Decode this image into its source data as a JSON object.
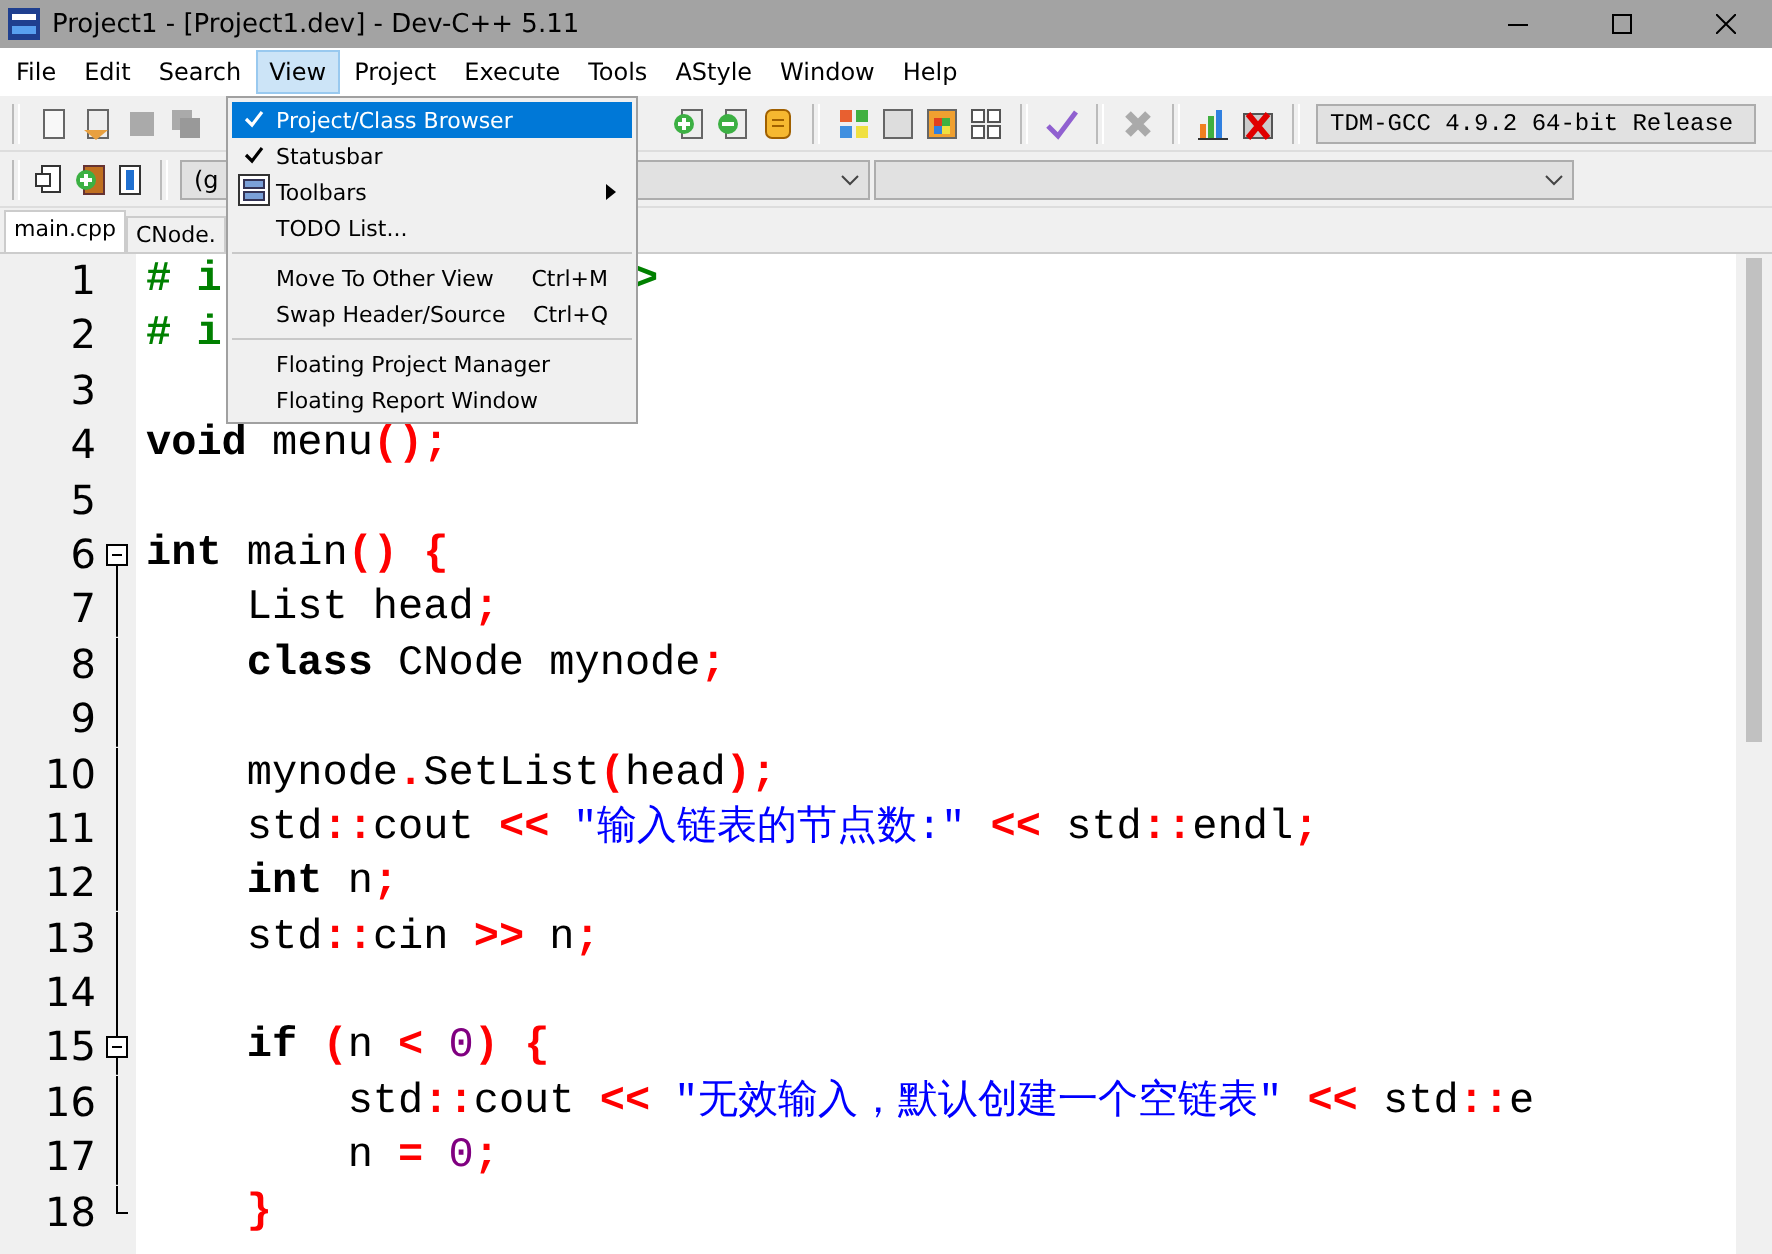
{
  "window": {
    "title": "Project1 - [Project1.dev] - Dev-C++ 5.11"
  },
  "menu_bar": [
    {
      "label": "File",
      "selected": false
    },
    {
      "label": "Edit",
      "selected": false
    },
    {
      "label": "Search",
      "selected": false
    },
    {
      "label": "View",
      "selected": true
    },
    {
      "label": "Project",
      "selected": false
    },
    {
      "label": "Execute",
      "selected": false
    },
    {
      "label": "Tools",
      "selected": false
    },
    {
      "label": "AStyle",
      "selected": false
    },
    {
      "label": "Window",
      "selected": false
    },
    {
      "label": "Help",
      "selected": false
    }
  ],
  "view_menu": {
    "items": [
      {
        "kind": "check",
        "label": "Project/Class Browser",
        "checked": true,
        "selected": true
      },
      {
        "kind": "check",
        "label": "Statusbar",
        "checked": true,
        "selected": false
      },
      {
        "kind": "submenu",
        "label": "Toolbars",
        "selected": false
      },
      {
        "kind": "item",
        "label": "TODO List...",
        "selected": false
      },
      {
        "kind": "separator"
      },
      {
        "kind": "item",
        "label": "Move To Other View",
        "shortcut": "Ctrl+M",
        "selected": false
      },
      {
        "kind": "item",
        "label": "Swap Header/Source",
        "shortcut": "Ctrl+Q",
        "selected": false
      },
      {
        "kind": "separator"
      },
      {
        "kind": "item",
        "label": "Floating Project Manager",
        "selected": false
      },
      {
        "kind": "item",
        "label": "Floating Report Window",
        "selected": false
      }
    ]
  },
  "compiler": {
    "value": "TDM-GCC 4.9.2 64-bit Release"
  },
  "scope_box": {
    "value": "(g"
  },
  "tabs": [
    {
      "label": "main.cpp",
      "selected": true
    },
    {
      "label": "CNode.",
      "selected": false
    }
  ],
  "editor": {
    "lines": [
      {
        "number": "1",
        "tokens": [
          {
            "kind": "pre",
            "text": "# i"
          },
          {
            "kind": "pre",
            "text": ">",
            "after_hidden": true
          }
        ]
      },
      {
        "number": "2",
        "tokens": [
          {
            "kind": "pre",
            "text": "# i"
          }
        ]
      },
      {
        "number": "3"
      },
      {
        "number": "4",
        "tokens": [
          {
            "kind": "kw",
            "text": "void"
          },
          {
            "kind": "id",
            "text": " menu"
          },
          {
            "kind": "sym",
            "text": "();"
          }
        ]
      },
      {
        "number": "5"
      },
      {
        "number": "6",
        "fold_start": true,
        "tokens": [
          {
            "kind": "kw",
            "text": "int"
          },
          {
            "kind": "id",
            "text": " main"
          },
          {
            "kind": "sym",
            "text": "()"
          },
          {
            "kind": "sym",
            "text": " {"
          }
        ]
      },
      {
        "number": "7",
        "tokens": [
          {
            "kind": "id",
            "text": "    List head"
          },
          {
            "kind": "sym",
            "text": ";"
          }
        ]
      },
      {
        "number": "8",
        "tokens": [
          {
            "kind": "kw",
            "text": "    class"
          },
          {
            "kind": "id",
            "text": " CNode mynode"
          },
          {
            "kind": "sym",
            "text": ";"
          }
        ]
      },
      {
        "number": "9"
      },
      {
        "number": "10",
        "tokens": [
          {
            "kind": "id",
            "text": "    mynode"
          },
          {
            "kind": "sym",
            "text": "."
          },
          {
            "kind": "id",
            "text": "SetList"
          },
          {
            "kind": "sym",
            "text": "("
          },
          {
            "kind": "id",
            "text": "head"
          },
          {
            "kind": "sym",
            "text": ");"
          }
        ]
      },
      {
        "number": "11",
        "tokens": [
          {
            "kind": "id",
            "text": "    std"
          },
          {
            "kind": "sym",
            "text": "::"
          },
          {
            "kind": "id",
            "text": "cout"
          },
          {
            "kind": "sym",
            "text": " <<"
          },
          {
            "kind": "str",
            "text": " \"输入链表的节点数:\""
          },
          {
            "kind": "sym",
            "text": " <<"
          },
          {
            "kind": "id",
            "text": " std"
          },
          {
            "kind": "sym",
            "text": "::"
          },
          {
            "kind": "id",
            "text": "endl"
          },
          {
            "kind": "sym",
            "text": ";"
          }
        ]
      },
      {
        "number": "12",
        "tokens": [
          {
            "kind": "kw",
            "text": "    int"
          },
          {
            "kind": "id",
            "text": " n"
          },
          {
            "kind": "sym",
            "text": ";"
          }
        ]
      },
      {
        "number": "13",
        "tokens": [
          {
            "kind": "id",
            "text": "    std"
          },
          {
            "kind": "sym",
            "text": "::"
          },
          {
            "kind": "id",
            "text": "cin"
          },
          {
            "kind": "sym",
            "text": " >>"
          },
          {
            "kind": "id",
            "text": " n"
          },
          {
            "kind": "sym",
            "text": ";"
          }
        ]
      },
      {
        "number": "14"
      },
      {
        "number": "15",
        "fold_start": true,
        "tokens": [
          {
            "kind": "kw",
            "text": "    if"
          },
          {
            "kind": "sym",
            "text": " ("
          },
          {
            "kind": "id",
            "text": "n"
          },
          {
            "kind": "sym",
            "text": " <"
          },
          {
            "kind": "num",
            "text": " 0"
          },
          {
            "kind": "sym",
            "text": ")"
          },
          {
            "kind": "sym",
            "text": " {"
          }
        ]
      },
      {
        "number": "16",
        "tokens": [
          {
            "kind": "id",
            "text": "        std"
          },
          {
            "kind": "sym",
            "text": "::"
          },
          {
            "kind": "id",
            "text": "cout"
          },
          {
            "kind": "sym",
            "text": " <<"
          },
          {
            "kind": "str",
            "text": " \"无效输入，默认创建一个空链表\""
          },
          {
            "kind": "sym",
            "text": " <<"
          },
          {
            "kind": "id",
            "text": " std"
          },
          {
            "kind": "sym",
            "text": "::"
          },
          {
            "kind": "id",
            "text": "e"
          }
        ]
      },
      {
        "number": "17",
        "tokens": [
          {
            "kind": "id",
            "text": "        n"
          },
          {
            "kind": "sym",
            "text": " ="
          },
          {
            "kind": "num",
            "text": " 0"
          },
          {
            "kind": "sym",
            "text": ";"
          }
        ]
      },
      {
        "number": "18",
        "fold_end": true,
        "tokens": [
          {
            "kind": "sym",
            "text": "    }"
          }
        ]
      }
    ]
  }
}
